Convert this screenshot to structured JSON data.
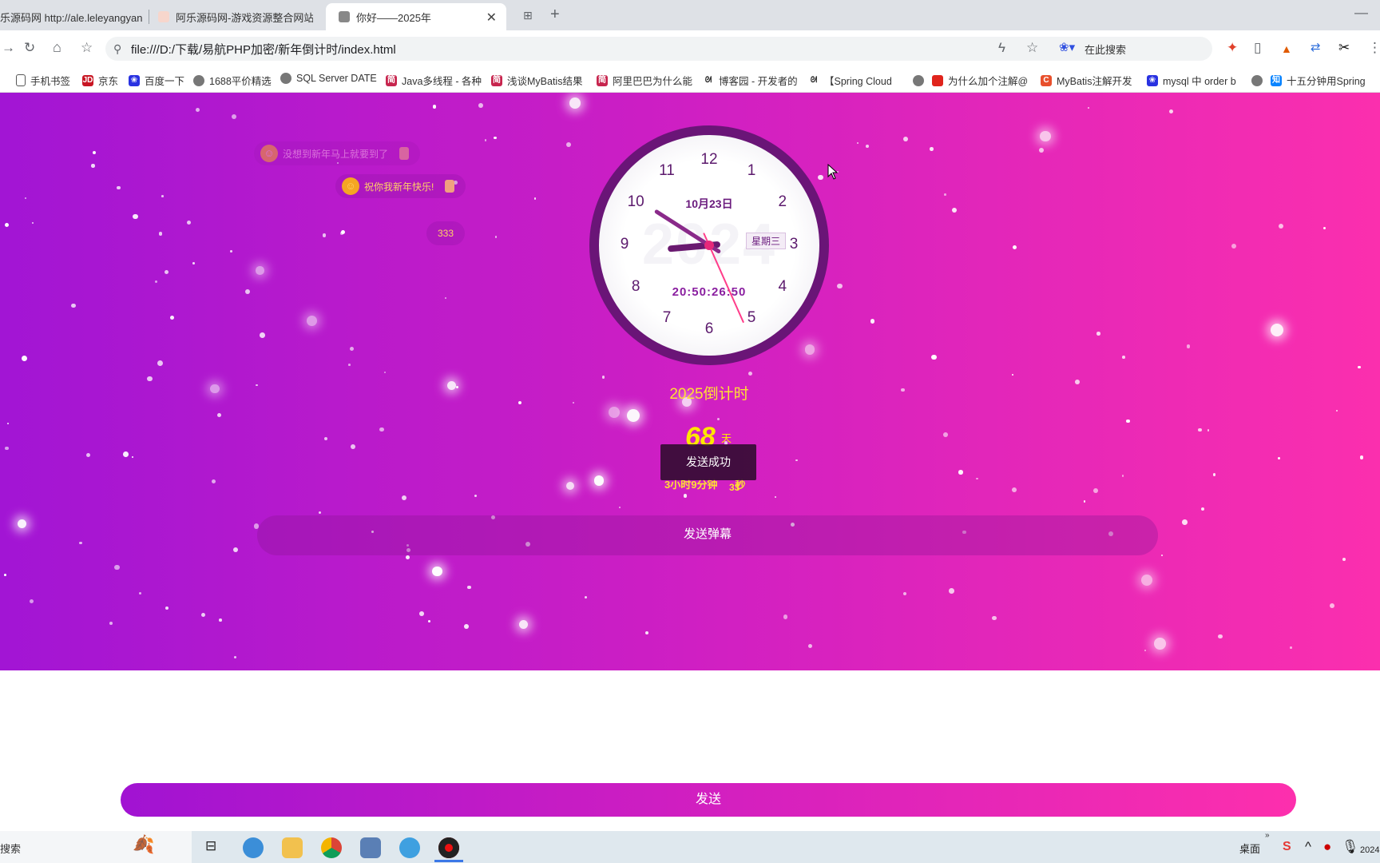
{
  "tabs": [
    {
      "label": "乐源码网 http://ale.leleyangyan"
    },
    {
      "label": "阿乐源码网-游戏资源整合网站,每"
    },
    {
      "label": "你好——2025年"
    }
  ],
  "address_bar": {
    "url": "file:///D:/下载/易航PHP加密/新年倒计时/index.html",
    "search_placeholder": "在此搜索"
  },
  "bookmarks": [
    "手机书签",
    "京东",
    "百度一下",
    "1688平价精选",
    "SQL Server DATE",
    "Java多线程 - 各种",
    "浅谈MyBatis结果",
    "阿里巴巴为什么能",
    "博客园 - 开发者的",
    "【Spring Cloud",
    "为什么加个注解@",
    "MyBatis注解开发",
    "mysql 中 order b",
    "十五分钟用Spring"
  ],
  "danmu": [
    "没想到新年马上就要到了",
    "祝你我新年快乐!",
    "333"
  ],
  "clock": {
    "numbers": [
      "12",
      "1",
      "2",
      "3",
      "4",
      "5",
      "6",
      "7",
      "8",
      "9",
      "10",
      "11"
    ],
    "date": "10月23日",
    "weekday": "星期三",
    "watermark": "2024",
    "digital_time": "20:50:26:50",
    "hour": 20,
    "minute": 50,
    "second": 26
  },
  "countdown": {
    "title": "2025倒计时",
    "days": "68",
    "days_unit": "天",
    "rest": "3小时9分钟",
    "seconds": "33",
    "seconds_unit": "秒"
  },
  "toast": "发送成功",
  "danmu_button": "发送弹幕",
  "send_button": "发送",
  "taskbar": {
    "search": "搜索",
    "desktop": "桌面",
    "year_fragment": "2024"
  },
  "colors": {
    "gradient_start": "#a215d4",
    "gradient_end": "#fb2fae",
    "accent_yellow": "#ffe033",
    "clock_ring": "#6a1577"
  }
}
